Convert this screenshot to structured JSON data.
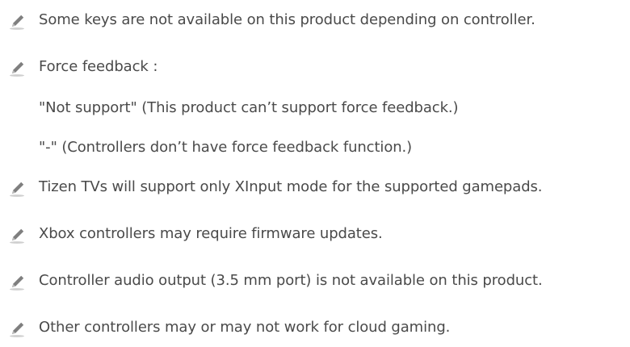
{
  "notes": [
    {
      "icon": "pencil-note-icon",
      "text": "Some keys are not available on this product depending on controller."
    },
    {
      "icon": "pencil-note-icon",
      "text": "Force feedback :"
    },
    {
      "icon": "",
      "text": "\"Not support\" (This product can’t support force feedback.)"
    },
    {
      "icon": "",
      "text": "\"-\" (Controllers don’t have force feedback function.)"
    },
    {
      "icon": "pencil-note-icon",
      "text": "Tizen TVs will support only XInput mode for the supported gamepads."
    },
    {
      "icon": "pencil-note-icon",
      "text": "Xbox controllers may require firmware updates."
    },
    {
      "icon": "pencil-note-icon",
      "text": "Controller audio output (3.5 mm port) is not available on this product."
    },
    {
      "icon": "pencil-note-icon",
      "text": "Other controllers may or may not work for cloud gaming."
    }
  ],
  "colors": {
    "text": "#4a4a4a",
    "icon": "#7f7f7f",
    "icon_shadow": "#cfcfcf"
  }
}
